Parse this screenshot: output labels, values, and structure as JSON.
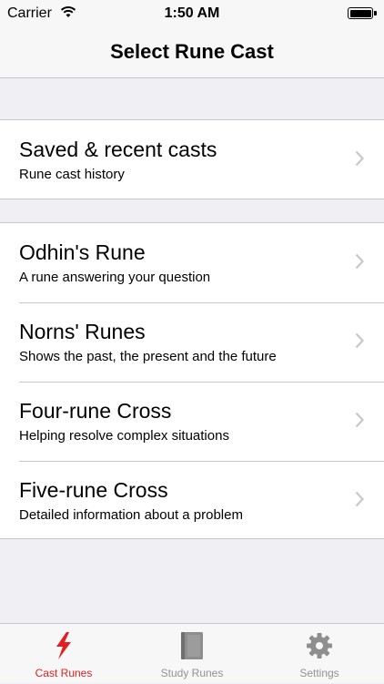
{
  "status_bar": {
    "carrier": "Carrier",
    "time": "1:50 AM"
  },
  "nav": {
    "title": "Select Rune Cast"
  },
  "groups": [
    {
      "cells": [
        {
          "title": "Saved & recent casts",
          "subtitle": "Rune cast history"
        }
      ]
    },
    {
      "cells": [
        {
          "title": "Odhin's Rune",
          "subtitle": "A rune answering your question"
        },
        {
          "title": "Norns' Runes",
          "subtitle": "Shows the past, the present and the future"
        },
        {
          "title": "Four-rune Cross",
          "subtitle": "Helping resolve complex situations"
        },
        {
          "title": "Five-rune Cross",
          "subtitle": "Detailed information about a problem"
        }
      ]
    }
  ],
  "tabs": [
    {
      "label": "Cast Runes",
      "icon": "lightning-icon",
      "active": true
    },
    {
      "label": "Study Runes",
      "icon": "book-icon",
      "active": false
    },
    {
      "label": "Settings",
      "icon": "gear-icon",
      "active": false
    }
  ],
  "colors": {
    "accent": "#e02020",
    "inactive": "#929292",
    "background": "#efeff4"
  }
}
